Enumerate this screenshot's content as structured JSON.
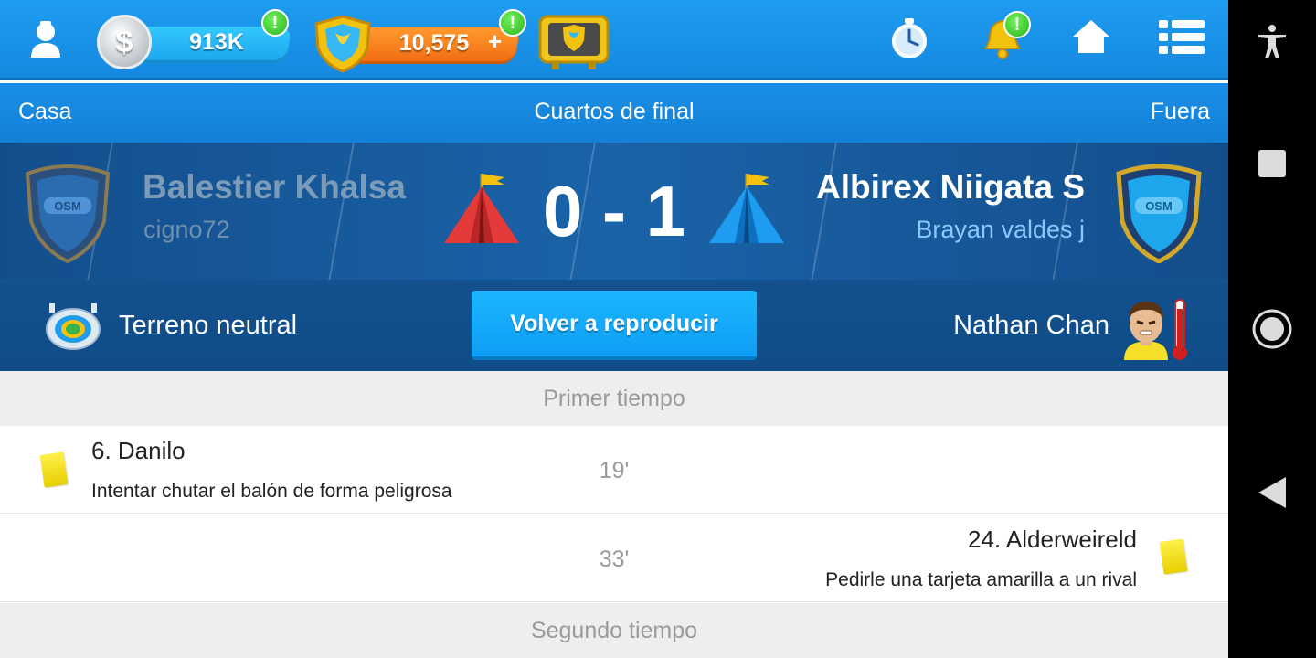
{
  "topbar": {
    "coins": {
      "value": "913K",
      "alert": "!",
      "symbol": "$"
    },
    "tokens": {
      "value": "10,575",
      "plus": "+",
      "alert": "!"
    },
    "notifications_alert": "!",
    "icons": [
      "user-avatar-icon",
      "coin-icon",
      "token-shield-icon",
      "tv-icon",
      "stopwatch-icon",
      "bell-icon",
      "home-icon",
      "menu-icon"
    ]
  },
  "round": {
    "home_label": "Casa",
    "title": "Cuartos de final",
    "away_label": "Fuera"
  },
  "match": {
    "home_team": "Balestier Khalsa",
    "home_manager": "cigno72",
    "away_team": "Albirex Niigata S",
    "away_manager": "Brayan valdes j",
    "score": "0 - 1",
    "crest_text": "OSM"
  },
  "info": {
    "venue": "Terreno neutral",
    "replay_button": "Volver a reproducir",
    "referee": "Nathan Chan"
  },
  "events": {
    "first_half_title": "Primer tiempo",
    "items": [
      {
        "player": "6. Danilo",
        "description": "Intentar chutar el balón de forma peligrosa",
        "minute": "19'",
        "side": "home",
        "card": "yellow"
      },
      {
        "player": "24. Alderweireld",
        "description": "Pedirle una tarjeta amarilla a un rival",
        "minute": "33'",
        "side": "away",
        "card": "yellow"
      }
    ],
    "second_half_title": "Segundo tiempo"
  },
  "colors": {
    "primary": "#1589df",
    "home_tent": "#e43a3a",
    "away_tent": "#1a8fe6",
    "yellow_card": "#f2dc12"
  }
}
